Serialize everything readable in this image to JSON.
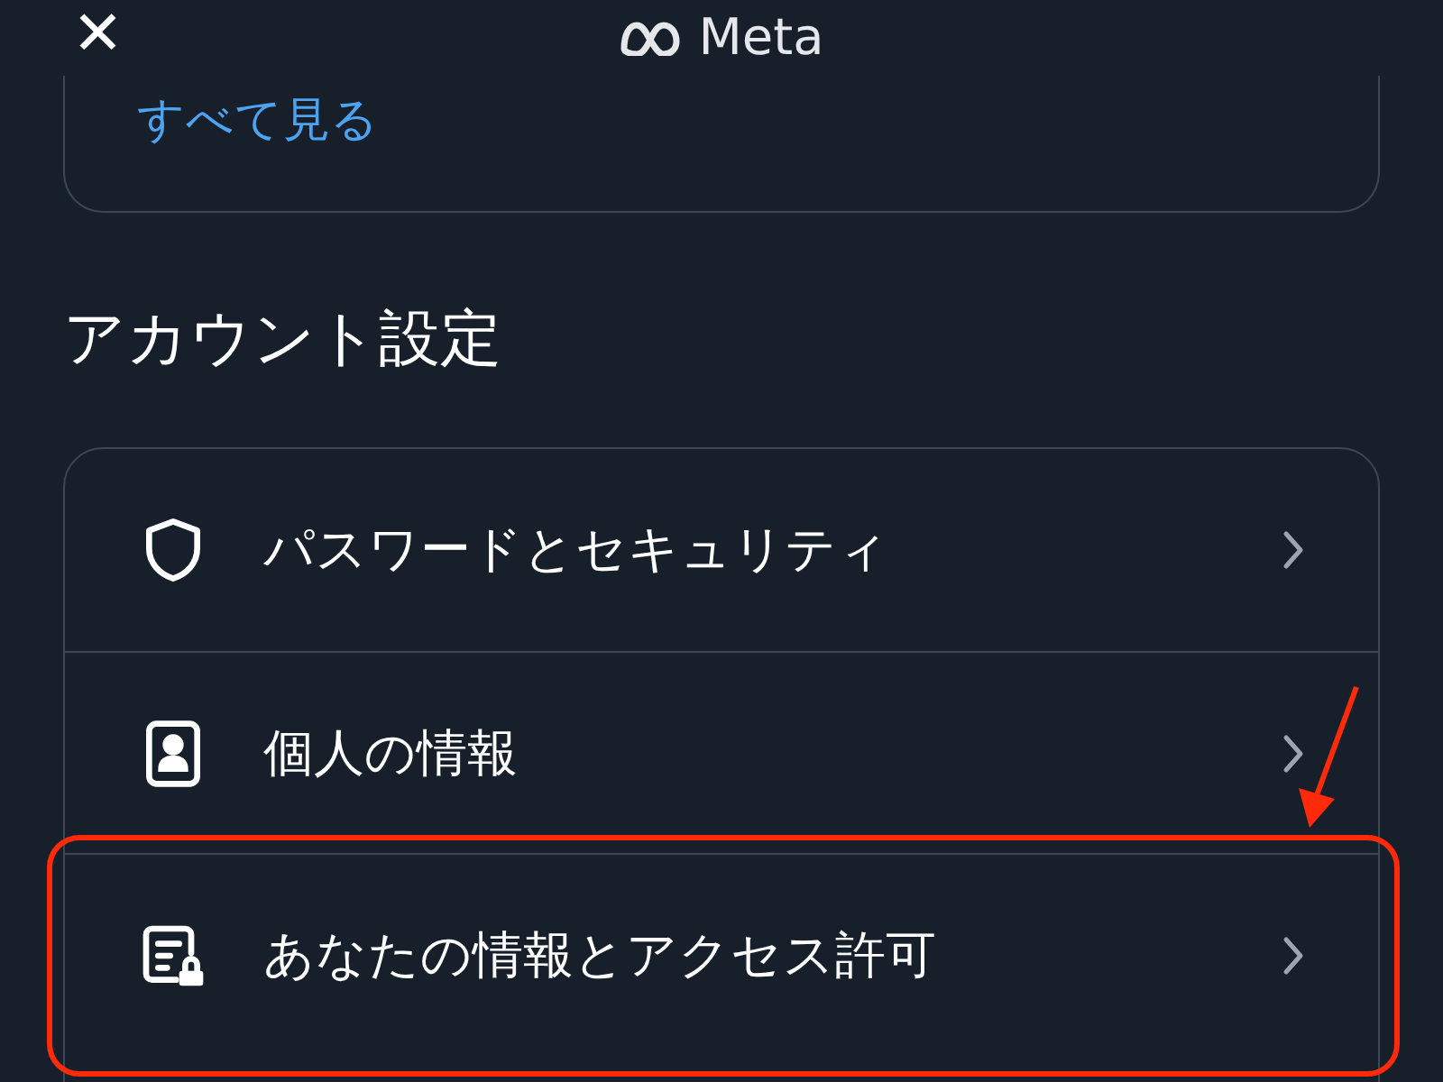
{
  "header": {
    "close": "✕",
    "title": "Meta"
  },
  "top_card": {
    "link": "すべて見る"
  },
  "section": {
    "title": "アカウント設定",
    "items": [
      {
        "kind": "shield",
        "label": "パスワードとセキュリティ",
        "annotated": false
      },
      {
        "kind": "id",
        "label": "個人の情報",
        "annotated": false
      },
      {
        "kind": "info-lock",
        "label": "あなたの情報とアクセス許可",
        "annotated": true
      }
    ]
  }
}
